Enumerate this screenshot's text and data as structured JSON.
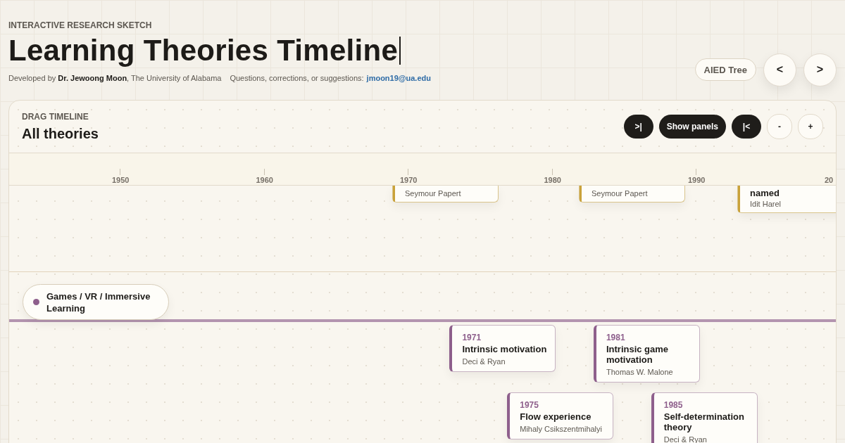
{
  "header": {
    "eyebrow": "INTERACTIVE RESEARCH SKETCH",
    "title": "Learning Theories Timeline",
    "credit": "Developed by **Dr. Jewoong Moon**, The University of Alabama",
    "contact_label": "Questions, corrections, or suggestions:",
    "contact_email": "jmoon19@ua.edu"
  },
  "nav": {
    "tree_button": "AIED Tree",
    "prev": "<",
    "next": ">"
  },
  "panel": {
    "eyebrow": "DRAG TIMELINE",
    "title": "All theories",
    "controls": [
      {
        "label": ">|",
        "kind": "dark"
      },
      {
        "label": "Show panels",
        "kind": "dark"
      },
      {
        "label": "|<",
        "kind": "dark"
      },
      {
        "label": "-",
        "kind": "light"
      },
      {
        "label": "+",
        "kind": "light"
      }
    ]
  },
  "axis": {
    "ticks": [
      "1950",
      "1960",
      "1970",
      "1980",
      "1990",
      "20"
    ]
  },
  "tracks": [
    {
      "color": "#c9a23a",
      "cards": [
        {
          "author": "Seymour Papert"
        },
        {
          "author": "Seymour Papert"
        },
        {
          "title": "named",
          "author": "Idit Harel"
        }
      ]
    },
    {
      "label": "Games / VR / Immersive Learning",
      "color": "#8e5f8c",
      "cards": [
        {
          "year": "1971",
          "title": "Intrinsic motivation",
          "author": "Deci & Ryan"
        },
        {
          "year": "1981",
          "title": "Intrinsic game motivation",
          "author": "Thomas W. Malone"
        },
        {
          "year": "1975",
          "title": "Flow experience",
          "author": "Mihaly Csikszentmihalyi"
        },
        {
          "year": "1985",
          "title": "Self-determination theory",
          "author": "Deci & Ryan"
        }
      ]
    }
  ]
}
